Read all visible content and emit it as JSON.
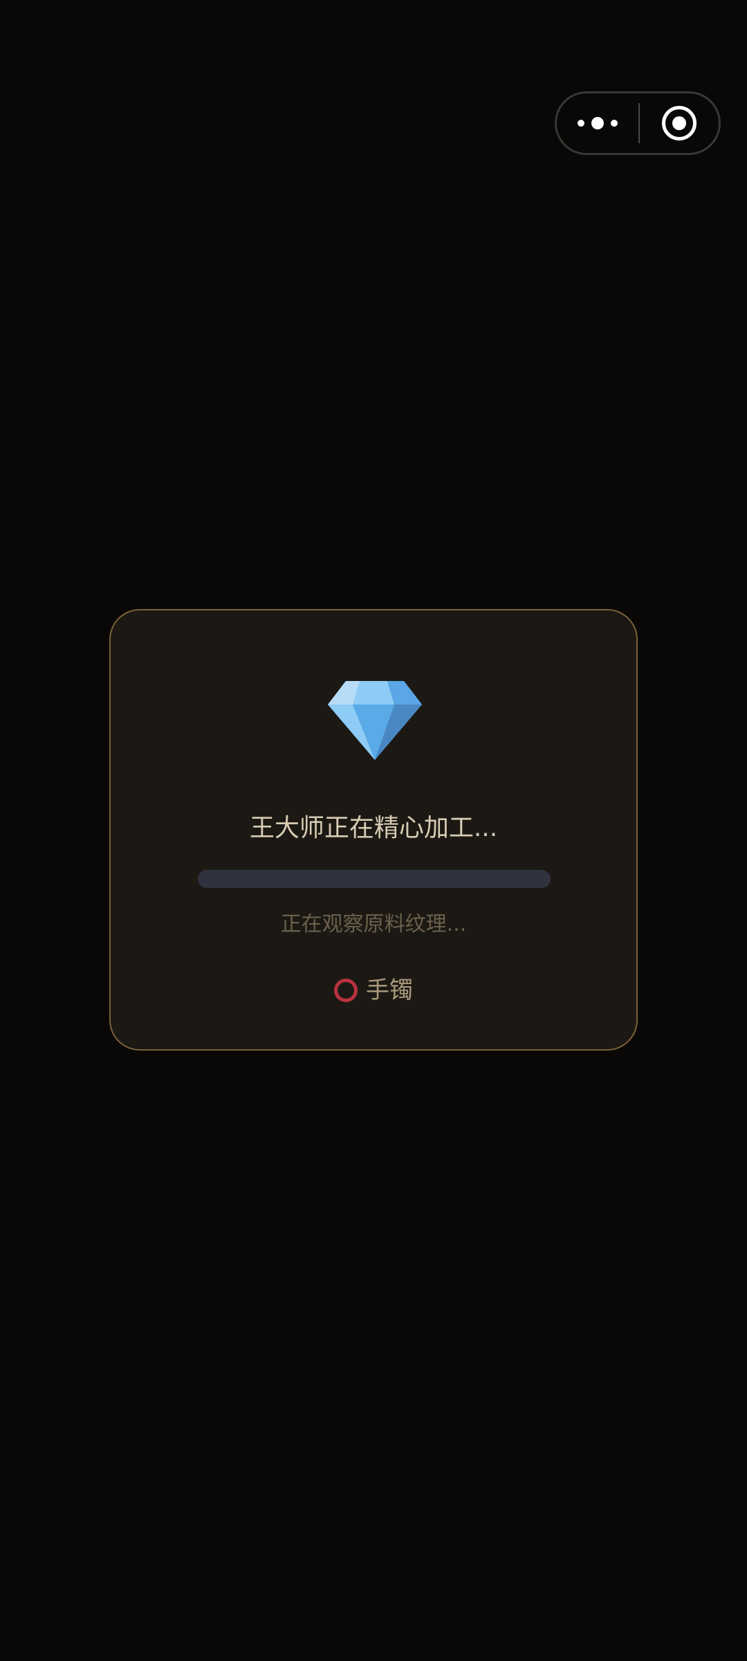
{
  "capsule": {
    "more_icon": "more-dots-icon",
    "close_icon": "close-target-icon"
  },
  "card": {
    "gem_icon": "diamond-icon",
    "title": "王大师正在精心加工...",
    "progress": 0,
    "status": "正在观察原料纹理...",
    "item": {
      "icon": "ring-circle-icon",
      "label": "手镯"
    }
  },
  "colors": {
    "background": "#0a0806",
    "card_bg": "#1c1914",
    "card_border": "#7a6238",
    "progress_track": "#303240",
    "ring_red": "#b8323f",
    "diamond_blue": "#5dade2"
  }
}
